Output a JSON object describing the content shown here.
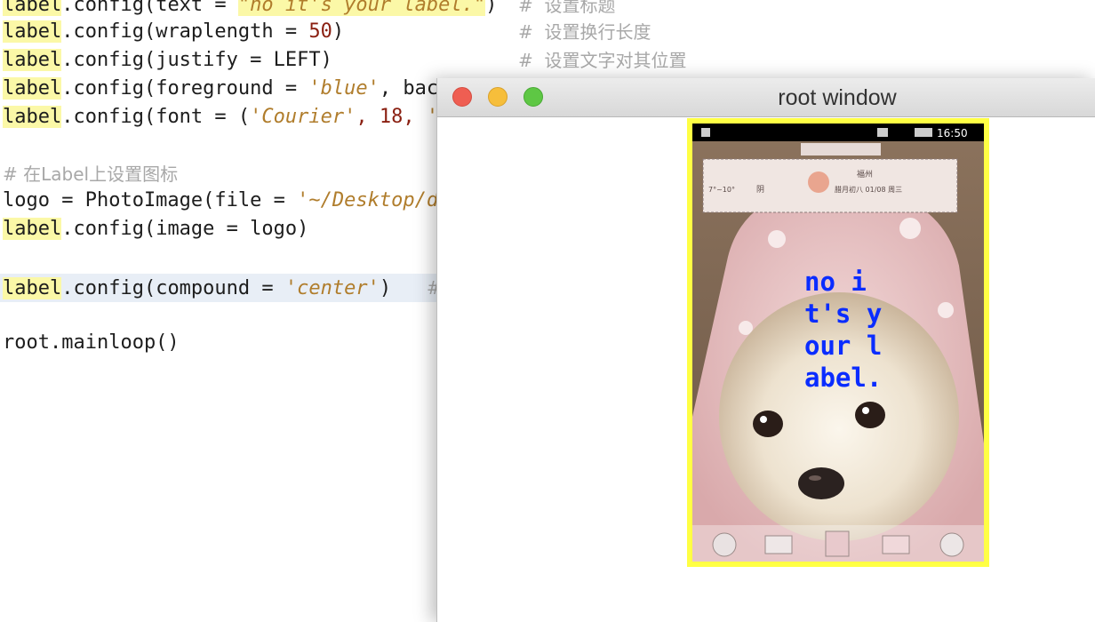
{
  "editor": {
    "lines": {
      "l0": {
        "obj": "label",
        "pre": ".config(text = ",
        "str": "\"no it's your label.\"",
        "post": ")",
        "cmt": "#  设置标题"
      },
      "l1": {
        "obj": "label",
        "pre": ".config(wraplength = ",
        "num": "50",
        "post": ")",
        "cmt": "#  设置换行长度"
      },
      "l2": {
        "obj": "label",
        "text": ".config(justify = LEFT)",
        "cmt": "#  设置文字对其位置"
      },
      "l3": {
        "obj": "label",
        "pre": ".config(foreground = ",
        "str": "'blue'",
        "post": ", bac"
      },
      "l4": {
        "obj": "label",
        "pre": ".config(font = (",
        "str": "'Courier'",
        "post": ", 18, ",
        "tail": "'"
      },
      "l5": {
        "cmt": "# 在Label上设置图标"
      },
      "l6": {
        "pre": "logo = PhotoImage(file = ",
        "str": "'~/Desktop/d"
      },
      "l7": {
        "obj": "label",
        "text": ".config(image = logo)"
      },
      "l8": {
        "obj": "label",
        "pre": ".config(compound = ",
        "str": "'center'",
        "post": ")   ",
        "cmt": "#"
      },
      "l9": {
        "text": "root.mainloop()"
      }
    }
  },
  "window": {
    "title": "root window",
    "label": {
      "text": "no it's your label.",
      "foreground": "#0a2cff",
      "background": "#ffff44"
    },
    "phone_status": {
      "time": "16:50"
    },
    "widget": {
      "city": "福州",
      "weather": "阴",
      "temp": "7°~10°",
      "date": "腊月初八 01/08 周三"
    },
    "dock_icons": [
      "phone-icon",
      "mail-icon",
      "contacts-icon",
      "messages-icon",
      "browser-icon"
    ]
  },
  "colors": {
    "highlight": "#fbf8a7",
    "string": "#b07d2c",
    "comment": "#a8a8a8",
    "number": "#8a1f11"
  }
}
